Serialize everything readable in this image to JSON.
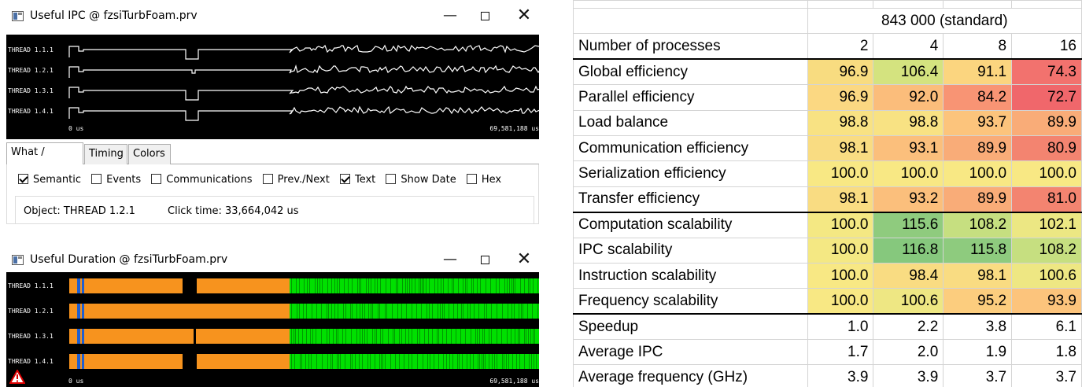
{
  "ipc_window": {
    "title": "Useful IPC @ fzsiTurbFoam.prv",
    "threads": [
      "THREAD 1.1.1",
      "THREAD 1.2.1",
      "THREAD 1.3.1",
      "THREAD 1.4.1"
    ],
    "time_start": "0 us",
    "time_end": "69,581,188 us",
    "tabs": [
      "What / Where",
      "Timing",
      "Colors"
    ],
    "active_tab": "What / Where",
    "checkboxes": [
      {
        "label": "Semantic",
        "checked": true
      },
      {
        "label": "Events",
        "checked": false
      },
      {
        "label": "Communications",
        "checked": false
      },
      {
        "label": "Prev./Next",
        "checked": false
      },
      {
        "label": "Text",
        "checked": true
      },
      {
        "label": "Show Date",
        "checked": false
      },
      {
        "label": "Hex",
        "checked": false
      }
    ],
    "object_text": "Object: THREAD 1.2.1",
    "click_time_text": "Click time: 33,664,042 us"
  },
  "duration_window": {
    "title": "Useful Duration @ fzsiTurbFoam.prv",
    "threads": [
      "THREAD 1.1.1",
      "THREAD 1.2.1",
      "THREAD 1.3.1",
      "THREAD 1.4.1"
    ],
    "time_start": "0 us",
    "time_end": "69,581,188 us",
    "colors": {
      "orange": "#f7931e",
      "green": "#00e000",
      "blue": "#1f5fd0",
      "black": "#000000"
    }
  },
  "window_controls": {
    "minimize": "—",
    "close": "✕"
  },
  "metrics_table": {
    "dataset_header": "843 000 (standard)",
    "header_label": "Number of processes",
    "columns": [
      "2",
      "4",
      "8",
      "16"
    ],
    "rows": [
      {
        "label": "Global efficiency",
        "indent": 0,
        "values": [
          "96.9",
          "106.4",
          "91.1",
          "74.3"
        ],
        "colors": [
          "#f8dc80",
          "#d4e37f",
          "#fbd57f",
          "#f2726e"
        ]
      },
      {
        "label": "Parallel efficiency",
        "indent": 0,
        "values": [
          "96.9",
          "92.0",
          "84.2",
          "72.7"
        ],
        "colors": [
          "#fbd882",
          "#fbbd7b",
          "#f89474",
          "#f0676b"
        ]
      },
      {
        "label": "Load balance",
        "indent": 1,
        "values": [
          "98.8",
          "98.8",
          "93.7",
          "89.9"
        ],
        "colors": [
          "#f8e283",
          "#f8e283",
          "#fcc47c",
          "#f9ac78"
        ]
      },
      {
        "label": "Communication efficiency",
        "indent": 1,
        "values": [
          "98.1",
          "93.1",
          "89.9",
          "80.9"
        ],
        "colors": [
          "#f9dc82",
          "#fbbf7c",
          "#f9ac78",
          "#f38470"
        ]
      },
      {
        "label": "Serialization efficiency",
        "indent": 2,
        "values": [
          "100.0",
          "100.0",
          "100.0",
          "100.0"
        ],
        "colors": [
          "#f8e884",
          "#f8e884",
          "#f8e884",
          "#f8e884"
        ]
      },
      {
        "label": "Transfer efficiency",
        "indent": 2,
        "values": [
          "98.1",
          "93.2",
          "89.9",
          "81.0"
        ],
        "colors": [
          "#f9dc82",
          "#fbbf7c",
          "#f9ac78",
          "#f38470"
        ]
      },
      {
        "label": "Computation scalability",
        "indent": 0,
        "values": [
          "100.0",
          "115.6",
          "108.2",
          "102.1"
        ],
        "colors": [
          "#f4e883",
          "#8fcb7e",
          "#c6df80",
          "#ece783"
        ]
      },
      {
        "label": "IPC scalability",
        "indent": 1,
        "values": [
          "100.0",
          "116.8",
          "115.8",
          "108.2"
        ],
        "colors": [
          "#f4e883",
          "#86c87d",
          "#8ecb7e",
          "#c6df80"
        ]
      },
      {
        "label": "Instruction scalability",
        "indent": 1,
        "values": [
          "100.0",
          "98.4",
          "98.1",
          "100.6"
        ],
        "colors": [
          "#f8e884",
          "#f9dc82",
          "#f9dc82",
          "#eee783"
        ]
      },
      {
        "label": "Frequency scalability",
        "indent": 1,
        "values": [
          "100.0",
          "100.6",
          "95.2",
          "93.9"
        ],
        "colors": [
          "#f8e884",
          "#eee783",
          "#fccd7e",
          "#fcc47c"
        ]
      },
      {
        "label": "Speedup",
        "indent": 0,
        "values": [
          "1.0",
          "2.2",
          "3.8",
          "6.1"
        ],
        "colors": [
          "",
          "",
          "",
          ""
        ]
      },
      {
        "label": "Average IPC",
        "indent": 0,
        "values": [
          "1.7",
          "2.0",
          "1.9",
          "1.8"
        ],
        "colors": [
          "",
          "",
          "",
          ""
        ]
      },
      {
        "label": "Average frequency (GHz)",
        "indent": 0,
        "values": [
          "3.9",
          "3.9",
          "3.7",
          "3.7"
        ],
        "colors": [
          "",
          "",
          "",
          ""
        ]
      }
    ]
  }
}
